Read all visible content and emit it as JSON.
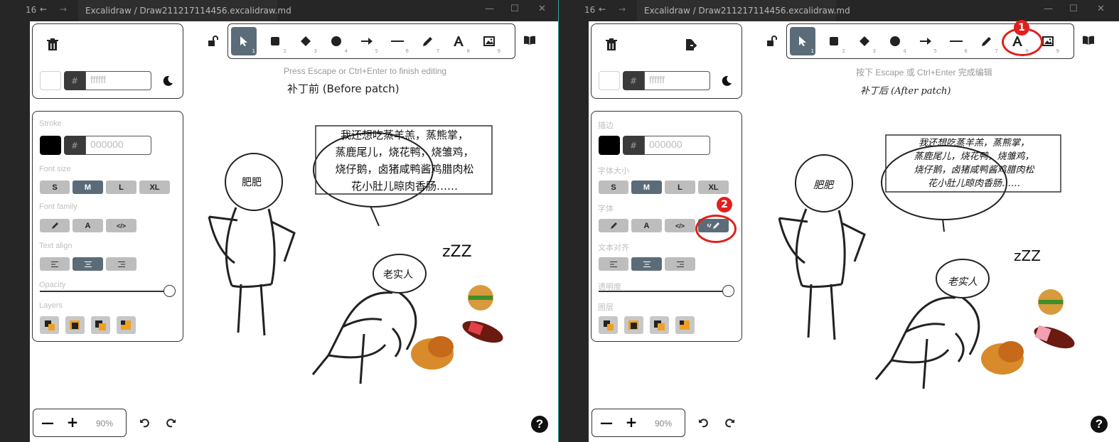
{
  "left": {
    "titlebar": {
      "count": "16",
      "back": "←",
      "forward": "→",
      "breadcrumb": "Excalidraw /",
      "file": "Draw211217114456.excalidraw.md",
      "minimize": "—",
      "maximize": "☐",
      "close": "✕"
    },
    "hex_bg_prefix": "#",
    "hex_bg_value": "ffffff",
    "stroke_label": "Stroke",
    "hex_stroke_prefix": "#",
    "hex_stroke_value": "000000",
    "font_size_label": "Font size",
    "sizes": [
      "S",
      "M",
      "L",
      "XL"
    ],
    "font_family_label": "Font family",
    "family_normal": "A",
    "family_code": "</>",
    "text_align_label": "Text align",
    "opacity_label": "Opacity",
    "opacity_value": 1.0,
    "layers_label": "Layers",
    "hint": "Press Escape or Ctrl+Enter to finish editing",
    "caption": "补丁前 (Before patch)",
    "speech_lines": [
      "我还想吃蒸羊羔，蒸熊掌，",
      "蒸鹿尾儿，烧花鸭，烧雏鸡，",
      "烧仔鹅，卤猪咸鸭酱鸡腊肉松",
      "花小肚儿晾肉香肠……"
    ],
    "name_fat": "肥肥",
    "name_honest": "老实人",
    "zzz": "zZZ",
    "zoom_out": "—",
    "zoom_in": "+",
    "zoom": "90%",
    "help": "?"
  },
  "right": {
    "titlebar": {
      "count": "16",
      "back": "←",
      "forward": "→",
      "breadcrumb": "Excalidraw /",
      "file": "Draw211217114456.excalidraw.md",
      "minimize": "—",
      "maximize": "☐",
      "close": "✕"
    },
    "hex_bg_prefix": "#",
    "hex_bg_value": "ffffff",
    "stroke_label": "描边",
    "hex_stroke_prefix": "#",
    "hex_stroke_value": "000000",
    "font_size_label": "字体大小",
    "sizes": [
      "S",
      "M",
      "L",
      "XL"
    ],
    "font_family_label": "字体",
    "family_normal": "A",
    "family_code": "</>",
    "text_align_label": "文本对齐",
    "opacity_label": "透明度",
    "opacity_value": 1.0,
    "layers_label": "图层",
    "hint": "按下 Escape 或 Ctrl+Enter 完成编辑",
    "caption": "补丁后 (After patch)",
    "speech_lines": [
      "我还想吃蒸羊羔，蒸熊掌，",
      "蒸鹿尾儿，烧花鸭，烧雏鸡，",
      "烧仔鹅，卤猪咸鸭酱鸡腊肉松",
      "花小肚儿晾肉香肠……"
    ],
    "name_fat": "肥肥",
    "name_honest": "老实人",
    "zzz": "zZZ",
    "zoom_out": "—",
    "zoom_in": "+",
    "zoom": "90%",
    "help": "?",
    "badge1": "1",
    "badge2": "2"
  },
  "colors": {
    "accent": "#5b6c78",
    "annotation": "#e0201c",
    "divider": "#2aa6a0"
  }
}
